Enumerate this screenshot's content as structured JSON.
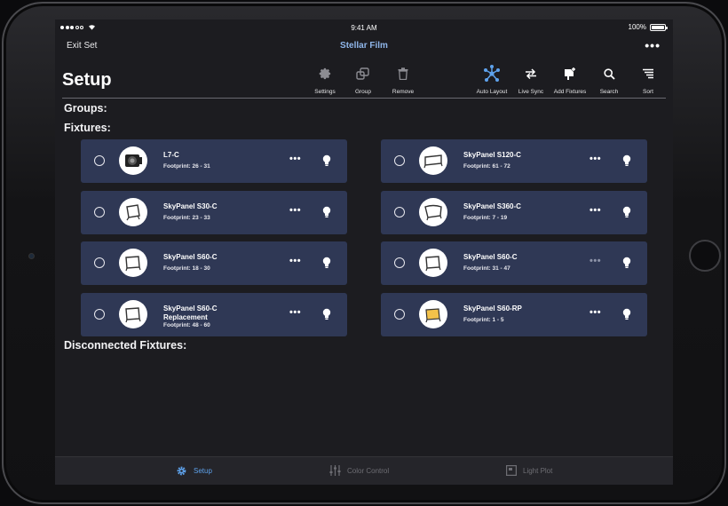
{
  "status_bar": {
    "time": "9:41 AM",
    "battery": "100%"
  },
  "nav": {
    "exit_label": "Exit Set",
    "title": "Stellar Film",
    "more_label": "•••"
  },
  "page": {
    "title": "Setup"
  },
  "toolbar": {
    "settings": "Settings",
    "group": "Group",
    "remove": "Remove",
    "auto_layout": "Auto Layout",
    "live_sync": "Live Sync",
    "add_fixtures": "Add Fixtures",
    "search": "Search",
    "sort": "Sort"
  },
  "sections": {
    "groups": "Groups:",
    "fixtures": "Fixtures:",
    "disconnected": "Disconnected Fixtures:"
  },
  "fixtures": [
    {
      "name": "L7-C",
      "extra": "",
      "footprint": "Footprint: 26 - 31"
    },
    {
      "name": "SkyPanel S120-C",
      "extra": "",
      "footprint": "Footprint: 61 - 72"
    },
    {
      "name": "SkyPanel S30-C",
      "extra": "",
      "footprint": "Footprint: 23 - 33"
    },
    {
      "name": "SkyPanel S360-C",
      "extra": "",
      "footprint": "Footprint: 7 - 19"
    },
    {
      "name": "SkyPanel S60-C",
      "extra": "",
      "footprint": "Footprint: 18 - 30"
    },
    {
      "name": "SkyPanel S60-C",
      "extra": "",
      "footprint": "Footprint: 31 - 47"
    },
    {
      "name": "SkyPanel S60-C",
      "extra": "Replacement",
      "footprint": "Footprint: 48 - 60"
    },
    {
      "name": "SkyPanel S60-RP",
      "extra": "",
      "footprint": "Footprint: 1 - 5"
    }
  ],
  "fixture_more_label": "•••",
  "tabs": {
    "setup": "Setup",
    "color_control": "Color Control",
    "light_plot": "Light Plot"
  },
  "colors": {
    "accent": "#5ea2ec",
    "card": "#2f3855",
    "background": "#1c1c20",
    "title": "#8fb6ea"
  }
}
